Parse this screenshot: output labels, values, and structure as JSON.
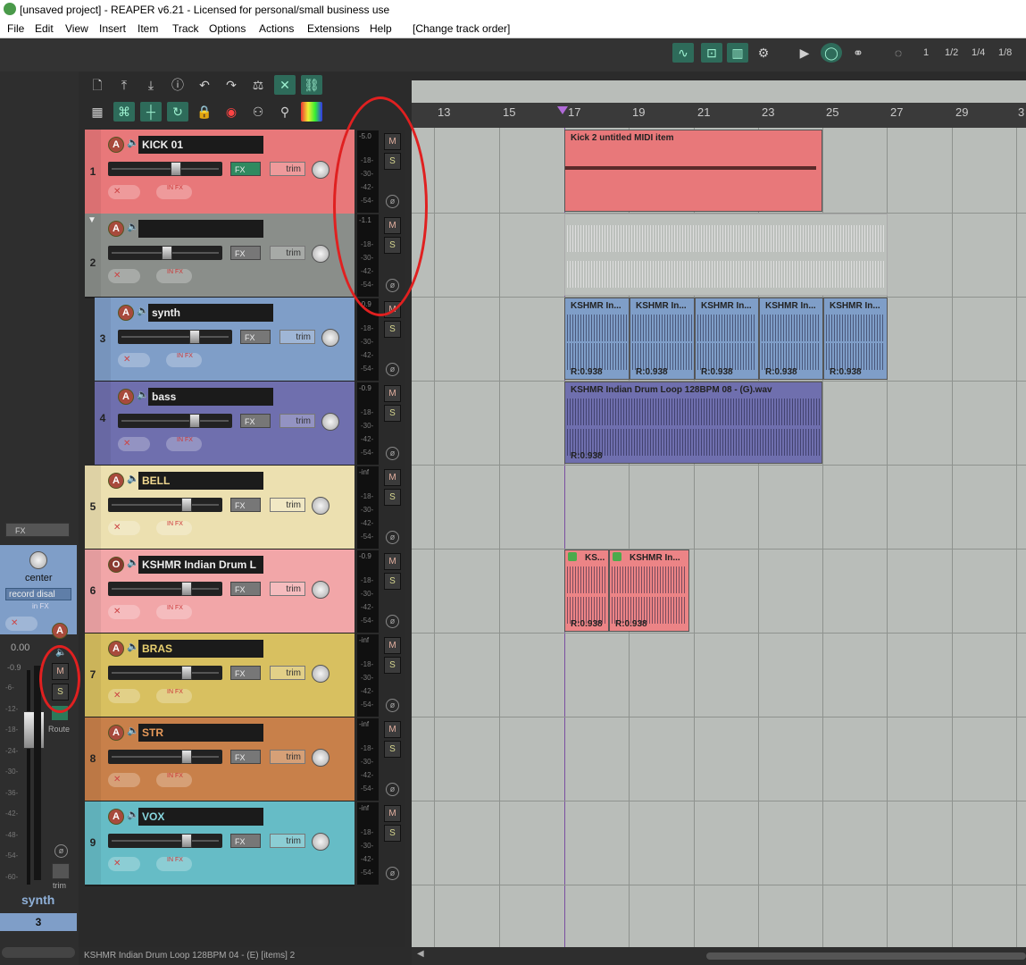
{
  "window": {
    "title": "[unsaved project] - REAPER v6.21 - Licensed for personal/small business use"
  },
  "menu": [
    "File",
    "Edit",
    "View",
    "Insert",
    "Item",
    "Track",
    "Options",
    "Actions",
    "Extensions",
    "Help",
    "[Change track order]"
  ],
  "transport": {
    "grid_values": [
      "1",
      "1/2",
      "1/4",
      "1/8"
    ]
  },
  "ruler": {
    "marks": [
      "13",
      "15",
      "17",
      "19",
      "21",
      "23",
      "25",
      "27",
      "29",
      "3"
    ]
  },
  "tracks": [
    {
      "num": "1",
      "name": "KICK 01",
      "color": "#e8787a",
      "meter": "-5.0"
    },
    {
      "num": "2",
      "name": "",
      "color": "#8a8e8a",
      "meter": "-1.1"
    },
    {
      "num": "3",
      "name": "synth",
      "color": "#7f9ec8",
      "meter": "-0.9"
    },
    {
      "num": "4",
      "name": "bass",
      "color": "#6f6fae",
      "meter": "-0.9"
    },
    {
      "num": "5",
      "name": "BELL",
      "color": "#ece0b0",
      "meter": "-inf"
    },
    {
      "num": "6",
      "name": "KSHMR Indian Drum L",
      "color": "#f2a6a8",
      "meter": "-0.9"
    },
    {
      "num": "7",
      "name": "BRAS",
      "color": "#d8c060",
      "meter": "-inf"
    },
    {
      "num": "8",
      "name": "STR",
      "color": "#c8804a",
      "meter": "-inf"
    },
    {
      "num": "9",
      "name": "VOX",
      "color": "#66bcc6",
      "meter": "-inf"
    }
  ],
  "labels": {
    "fx": "FX",
    "trim": "trim",
    "in_fx": "IN FX",
    "mute": "M",
    "solo": "S",
    "rec": "A",
    "rec_off": "O"
  },
  "meter_scale": [
    "-18-",
    "-30-",
    "-42-",
    "-54-"
  ],
  "items": {
    "midi": "Kick 2 untitled MIDI item",
    "synth_clip": "KSHMR In...",
    "rate": "R:0.938",
    "bass_clip": "KSHMR Indian Drum Loop 128BPM 08 - (G).wav",
    "t6_clip_a": "KS...",
    "t6_clip_b": "KSHMR In..."
  },
  "mixer": {
    "fx": "FX",
    "pan": "center",
    "record": "record disal",
    "in_fx": "in FX",
    "volume": "0.00",
    "peak": "-0.9",
    "scale": [
      "-6-",
      "-12-",
      "-18-",
      "-24-",
      "-30-",
      "-36-",
      "-42-",
      "-48-",
      "-54-",
      "-60-"
    ],
    "route": "Route",
    "trim": "trim",
    "name": "synth",
    "number": "3"
  },
  "status": "KSHMR Indian Drum Loop 128BPM 04 - (E) [items] 2"
}
